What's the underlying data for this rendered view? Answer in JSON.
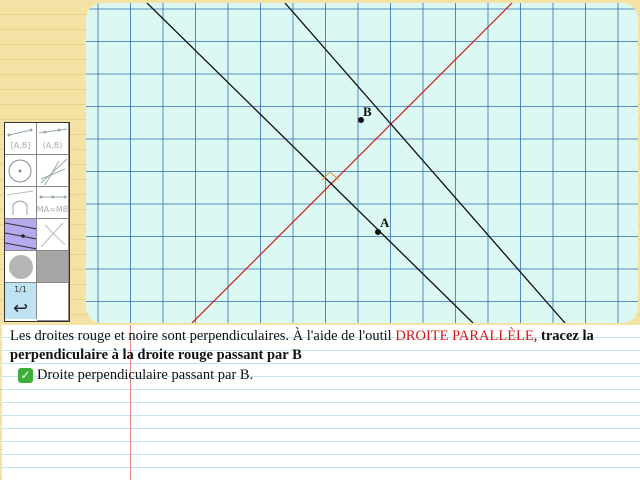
{
  "canvas": {
    "point_a_label": "A",
    "point_b_label": "B",
    "colors": {
      "red_line": "#d22424",
      "black_line": "#111111",
      "grid": "#2f6fb3",
      "background": "#dcf8f3"
    }
  },
  "toolbar": {
    "segment_label": "[A,B]",
    "ray_label": "(A,B)",
    "circle_label": "",
    "midpoint_label": "MA=MB",
    "page_counter": "1/1",
    "back_symbol": "↩"
  },
  "instruction": {
    "part1": "Les droites rouge et noire sont perpendiculaires. À l'aide de l'outil ",
    "tool_name": "DROITE PARALLÈLE",
    "part2": ", ",
    "bold": "tracez la perpendiculaire à la droite rouge passant par B"
  },
  "feedback": {
    "icon": "check-icon",
    "text": "Droite perpendiculaire passant par B."
  }
}
